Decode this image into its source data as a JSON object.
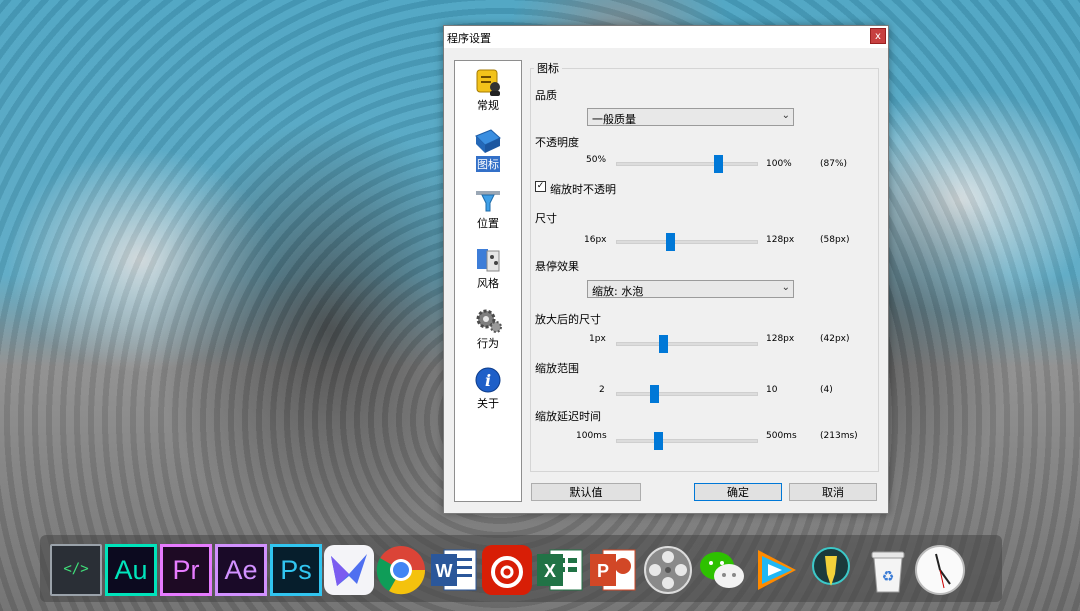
{
  "window": {
    "title": "程序设置",
    "close_label": "x"
  },
  "nav": {
    "items": [
      {
        "label": "常规",
        "icon": "general-icon"
      },
      {
        "label": "图标",
        "icon": "icons-icon",
        "active": true
      },
      {
        "label": "位置",
        "icon": "position-icon"
      },
      {
        "label": "风格",
        "icon": "style-icon"
      },
      {
        "label": "行为",
        "icon": "behavior-icon"
      },
      {
        "label": "关于",
        "icon": "about-icon"
      }
    ]
  },
  "panel": {
    "group_title": "图标",
    "quality": {
      "label": "品质",
      "value": "一般质量"
    },
    "opacity": {
      "label": "不透明度",
      "min": "50%",
      "max": "100%",
      "value": "(87%)",
      "level": 0.74
    },
    "opaque_zoom": {
      "label": "缩放时不透明",
      "checked": true
    },
    "size": {
      "label": "尺寸",
      "min": "16px",
      "max": "128px",
      "value": "(58px)",
      "level": 0.375
    },
    "hover": {
      "label": "悬停效果",
      "value": "缩放: 水泡"
    },
    "zoomed_size": {
      "label": "放大后的尺寸",
      "min": "1px",
      "max": "128px",
      "value": "(42px)",
      "level": 0.32
    },
    "zoom_range": {
      "label": "缩放范围",
      "min": "2",
      "max": "10",
      "value": "(4)",
      "level": 0.25
    },
    "zoom_delay": {
      "label": "缩放延迟时间",
      "min": "100ms",
      "max": "500ms",
      "value": "(213ms)",
      "level": 0.28
    }
  },
  "buttons": {
    "default": "默认值",
    "ok": "确定",
    "cancel": "取消"
  },
  "dock": {
    "apps": [
      {
        "name": "code-editor",
        "label": "</>"
      },
      {
        "name": "audition",
        "label": "Au",
        "color": "#00e4bb"
      },
      {
        "name": "premiere",
        "label": "Pr",
        "color": "#e77bff"
      },
      {
        "name": "after-effects",
        "label": "Ae",
        "color": "#d291ff"
      },
      {
        "name": "photoshop",
        "label": "Ps",
        "color": "#31c5f0"
      },
      {
        "name": "feishu"
      },
      {
        "name": "chrome"
      },
      {
        "name": "word"
      },
      {
        "name": "netease-music"
      },
      {
        "name": "excel"
      },
      {
        "name": "powerpoint"
      },
      {
        "name": "video-player"
      },
      {
        "name": "wechat"
      },
      {
        "name": "tencent-video"
      },
      {
        "name": "map-pin"
      },
      {
        "name": "recycle-bin"
      },
      {
        "name": "clock"
      }
    ]
  }
}
